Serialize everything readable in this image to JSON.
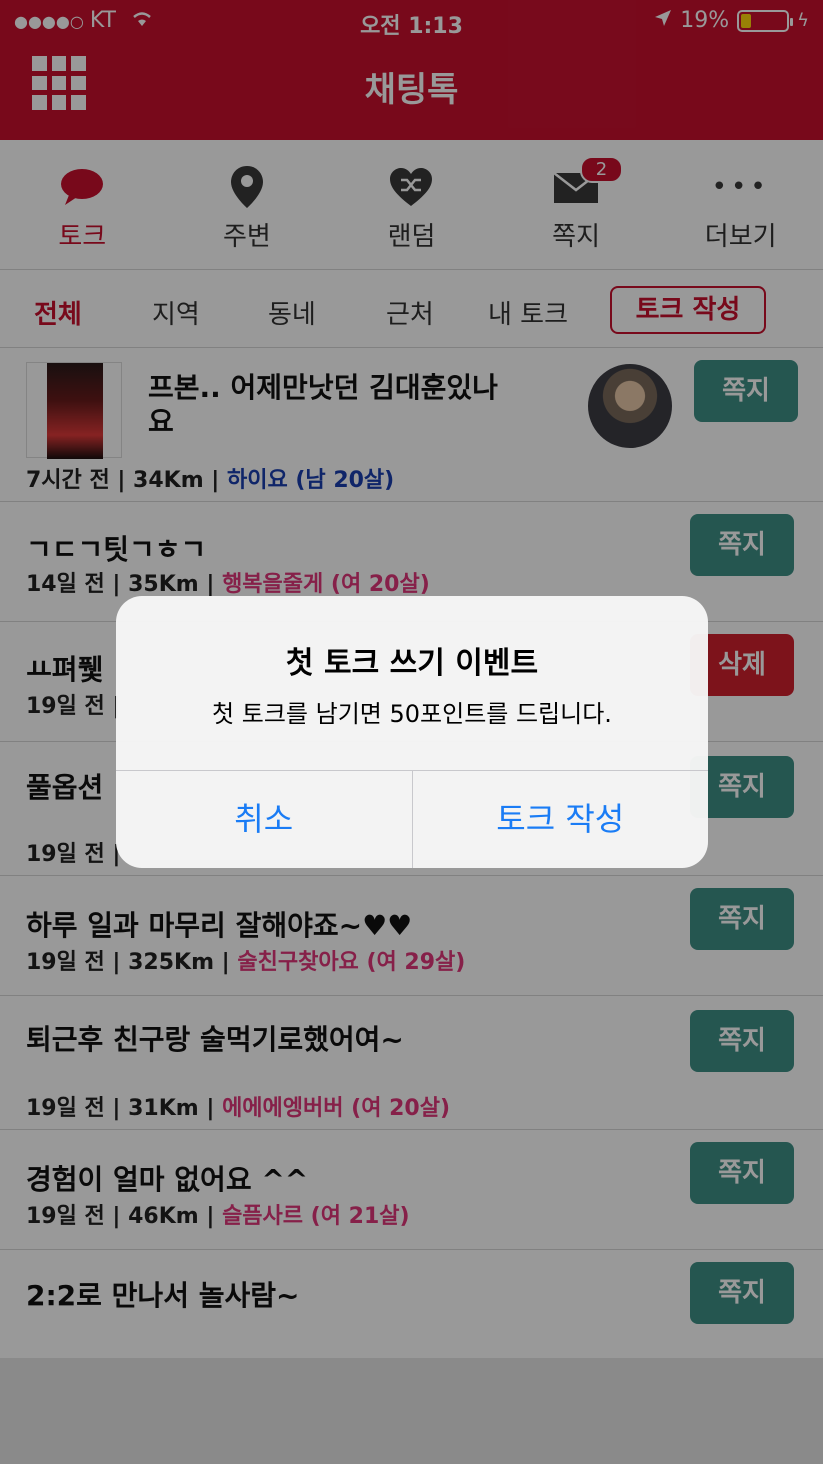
{
  "status_bar": {
    "carrier": "KT",
    "time": "오전 1:13",
    "battery": "19%"
  },
  "header": {
    "title": "채팅톡"
  },
  "nav": {
    "items": [
      {
        "label": "토크",
        "icon": "chat-bubble-icon"
      },
      {
        "label": "주변",
        "icon": "location-pin-icon"
      },
      {
        "label": "랜덤",
        "icon": "shuffle-heart-icon"
      },
      {
        "label": "쪽지",
        "icon": "envelope-icon",
        "badge": "2"
      },
      {
        "label": "더보기",
        "icon": "more-dots-icon"
      }
    ]
  },
  "filters": {
    "items": [
      "전체",
      "지역",
      "동네",
      "근처",
      "내 토크"
    ],
    "write_button": "토크 작성"
  },
  "posts": [
    {
      "title_line1": "프본..   어제만낫던 김대훈있나",
      "title_line2": "요",
      "meta_prefix": "7시간 전 | 34Km | ",
      "user": "하이요 (남 20살)",
      "button": "쪽지"
    },
    {
      "title_line1": "ㄱㄷㄱ팃ㄱㅎㄱ",
      "meta_prefix": "14일 전 | 35Km | ",
      "user": "행복을줄게 (여 20살)",
      "button": "쪽지"
    },
    {
      "title_line1": "ㅛ펴퓇",
      "meta_prefix": "19일 전 | ",
      "user": "",
      "button": "삭제"
    },
    {
      "title_line1": "풀옵션",
      "meta_prefix": "19일 전 | ",
      "user": "",
      "button": "쪽지"
    },
    {
      "title_line1": "하루 일과 마무리 잘해야죠~♥♥",
      "meta_prefix": "19일 전 | 325Km | ",
      "user": "술친구찾아요 (여 29살)",
      "button": "쪽지"
    },
    {
      "title_line1": "퇴근후 친구랑 술먹기로했어여~",
      "meta_prefix": "19일 전 | 31Km | ",
      "user": "에에에엥버버 (여 20살)",
      "button": "쪽지"
    },
    {
      "title_line1": "경험이 얼마 없어요 ^^",
      "meta_prefix": "19일 전 | 46Km | ",
      "user": "슬픔사르 (여 21살)",
      "button": "쪽지"
    },
    {
      "title_line1": "2:2로 만나서 놀사람~",
      "meta_prefix": "",
      "user": "",
      "button": "쪽지"
    }
  ],
  "alert": {
    "title": "첫 토크 쓰기 이벤트",
    "message": "첫 토크를 남기면 50포인트를 드립니다.",
    "cancel": "취소",
    "confirm": "토크 작성"
  },
  "colors": {
    "brand_red": "#c8102e",
    "button_teal": "#3f8f86",
    "delete_red": "#d0202e",
    "alert_blue": "#1a7cf5",
    "male_user": "#1a3fb0",
    "female_user": "#e0367a"
  }
}
